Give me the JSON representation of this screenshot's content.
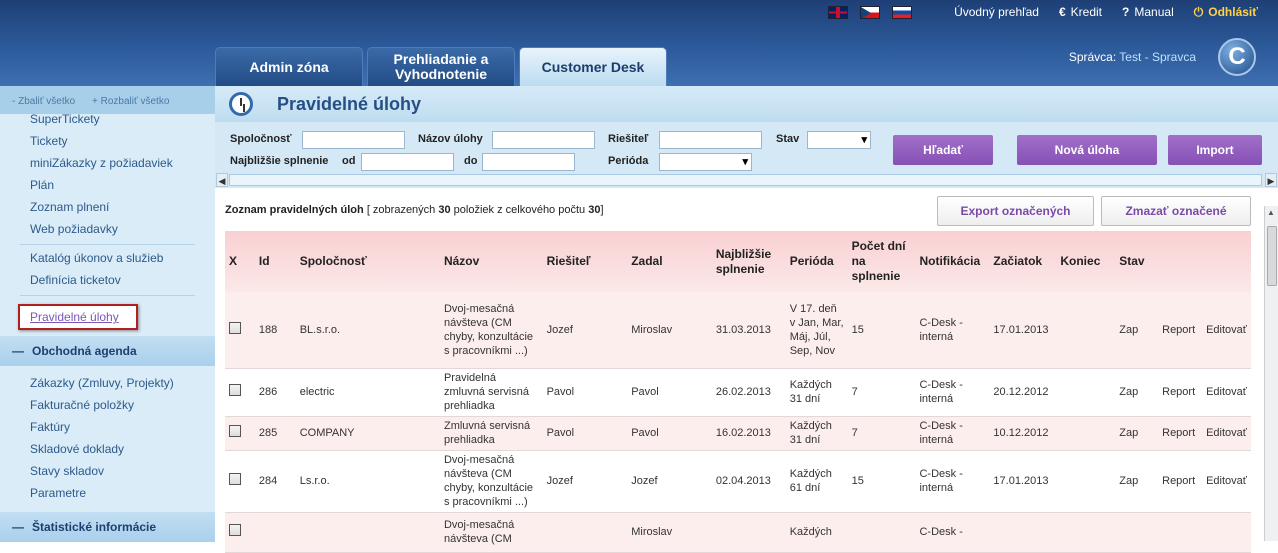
{
  "topbar": {
    "flags": [
      "en",
      "cz",
      "sk"
    ],
    "links": [
      {
        "label": "Úvodný prehľad",
        "icon": ""
      },
      {
        "label": "Kredit",
        "icon": "€"
      },
      {
        "label": "Manual",
        "icon": "?"
      },
      {
        "label": "Odhlásiť",
        "icon": "⏻"
      }
    ]
  },
  "tabs": [
    {
      "label": "Admin zóna"
    },
    {
      "label": "Prehliadanie a Vyhodnotenie"
    },
    {
      "label": "Customer Desk"
    }
  ],
  "admin": {
    "prefix": "Správca:",
    "name": "Test - Spravca",
    "logo_letter": "C"
  },
  "sidebar": {
    "collapse": "- Zbaliť všetko",
    "expand": "+ Rozbaliť všetko",
    "group1": [
      "SuperTickety",
      "Tickety",
      "miniZákazky z požiadaviek",
      "Plán",
      "Zoznam plnení",
      "Web požiadavky"
    ],
    "group2": [
      "Katalóg úkonov a služieb",
      "Definícia ticketov"
    ],
    "active": "Pravidelné úlohy",
    "section1": "Obchodná agenda",
    "group3": [
      "Zákazky (Zmluvy, Projekty)",
      "Fakturačné položky",
      "Faktúry",
      "Skladové doklady",
      "Stavy skladov",
      "Parametre"
    ],
    "section2": "Štatistické informácie"
  },
  "page": {
    "title": "Pravidelné úlohy"
  },
  "filters": {
    "company": "Spoločnosť",
    "task_name": "Názov úlohy",
    "solver": "Riešiteľ",
    "status": "Stav",
    "nearest": "Najbližšie splnenie",
    "from": "od",
    "to": "do",
    "period": "Perióda",
    "search_btn": "Hľadať",
    "new_btn": "Nová úloha",
    "import_btn": "Import"
  },
  "list": {
    "title": "Zoznam pravidelných úloh",
    "count_prefix": "[ zobrazených",
    "shown": "30",
    "count_middle": "položiek z celkového počtu",
    "total": "30",
    "count_suffix": "]",
    "export_btn": "Export označených",
    "delete_btn": "Zmazať označené"
  },
  "table": {
    "headers": [
      "X",
      "Id",
      "Spoločnosť",
      "Názov",
      "Riešiteľ",
      "Zadal",
      "Najbližšie splnenie",
      "Perióda",
      "Počet dní na splnenie",
      "Notifikácia",
      "Začiatok",
      "Koniec",
      "Stav",
      "",
      ""
    ],
    "rows": [
      {
        "id": "188",
        "company": "BL.s.r.o.",
        "name": "Dvoj-mesačná návšteva (CM chyby, konzultácie s pracovníkmi ...)",
        "solver": "Jozef",
        "by": "Miroslav",
        "next": "31.03.2013",
        "period": "V 17. deň v Jan, Mar, Máj, Júl, Sep, Nov",
        "days": "15",
        "notif": "C-Desk - interná",
        "start": "17.01.2013",
        "end": "",
        "status": "Zap",
        "report": "Report",
        "edit": "Editovať"
      },
      {
        "id": "286",
        "company": "electric",
        "name": "Pravidelná zmluvná servisná prehliadka",
        "solver": "Pavol",
        "by": "Pavol",
        "next": "26.02.2013",
        "period": "Každých 31 dní",
        "days": "7",
        "notif": "C-Desk - interná",
        "start": "20.12.2012",
        "end": "",
        "status": "Zap",
        "report": "Report",
        "edit": "Editovať"
      },
      {
        "id": "285",
        "company": "COMPANY",
        "name": "Zmluvná servisná prehliadka",
        "solver": "Pavol",
        "by": "Pavol",
        "next": "16.02.2013",
        "period": "Každých 31 dní",
        "days": "7",
        "notif": "C-Desk - interná",
        "start": "10.12.2012",
        "end": "",
        "status": "Zap",
        "report": "Report",
        "edit": "Editovať"
      },
      {
        "id": "284",
        "company": "Ls.r.o.",
        "name": "Dvoj-mesačná návšteva (CM chyby, konzultácie s pracovníkmi ...)",
        "solver": "Jozef",
        "by": "Jozef",
        "next": "02.04.2013",
        "period": "Každých 61 dní",
        "days": "15",
        "notif": "C-Desk - interná",
        "start": "17.01.2013",
        "end": "",
        "status": "Zap",
        "report": "Report",
        "edit": "Editovať"
      },
      {
        "id": "",
        "company": "",
        "name": "Dvoj-mesačná návšteva (CM",
        "solver": "",
        "by": "Miroslav",
        "next": "",
        "period": "Každých",
        "days": "",
        "notif": "C-Desk -",
        "start": "",
        "end": "",
        "status": "",
        "report": "",
        "edit": ""
      }
    ]
  }
}
